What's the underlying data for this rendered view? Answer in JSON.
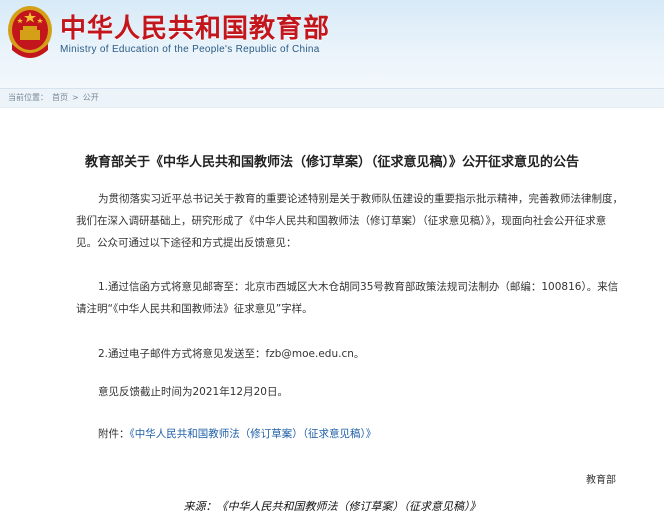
{
  "header": {
    "site_title": "中华人民共和国教育部",
    "site_subtitle": "Ministry of Education of the People's Republic of China"
  },
  "breadcrumb": {
    "prefix": "当前位置：",
    "home": "首页",
    "sep1": ">",
    "current": "公开"
  },
  "article": {
    "title": "教育部关于《中华人民共和国教师法（修订草案）（征求意见稿）》公开征求意见的公告",
    "para1": "为贯彻落实习近平总书记关于教育的重要论述特别是关于教师队伍建设的重要指示批示精神，完善教师法律制度，我们在深入调研基础上，研究形成了《中华人民共和国教师法（修订草案）（征求意见稿）》，现面向社会公开征求意见。公众可通过以下途径和方式提出反馈意见：",
    "para2": "1.通过信函方式将意见邮寄至：北京市西城区大木仓胡同35号教育部政策法规司法制办（邮编：100816）。来信请注明“《中华人民共和国教师法》征求意见”字样。",
    "para3": "2.通过电子邮件方式将意见发送至：fzb@moe.edu.cn。",
    "para4": "意见反馈截止时间为2021年12月20日。",
    "attachment_label": "附件：",
    "attachment_link": "《中华人民共和国教师法（修订草案）（征求意见稿）》",
    "signature": "教育部"
  },
  "caption": "来源：《中华人民共和国教师法（修订草案）（征求意见稿）》",
  "colors": {
    "brand_red": "#c3161c",
    "link_blue": "#1e5fa8"
  },
  "icons": {
    "emblem": "national-emblem-icon"
  }
}
